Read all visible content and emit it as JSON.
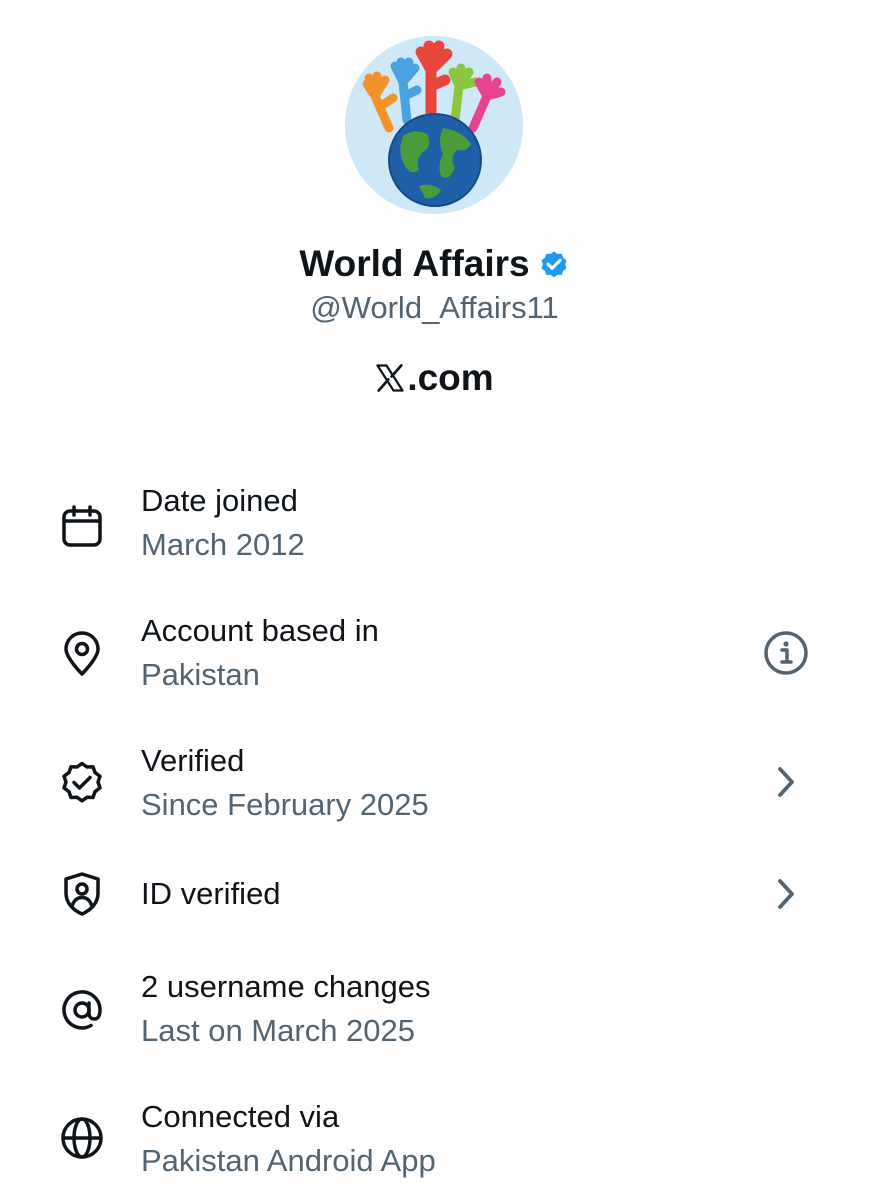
{
  "profile": {
    "display_name": "World Affairs",
    "handle": "@World_Affairs11",
    "verified_icon": "verified-badge-icon",
    "avatar_icon": "globe-with-raised-hands-avatar"
  },
  "brand": {
    "logo_icon": "x-logo-icon",
    "domain_text": ".com"
  },
  "colors": {
    "verified_blue": "#1d9bf0",
    "primary_text": "#0f1419",
    "secondary_text": "#536471"
  },
  "rows": [
    {
      "icon": "calendar-icon",
      "title": "Date joined",
      "subtitle": "March 2012"
    },
    {
      "icon": "location-pin-icon",
      "title": "Account based in",
      "subtitle": "Pakistan",
      "action_icon": "info-icon"
    },
    {
      "icon": "verified-badge-outline-icon",
      "title": "Verified",
      "subtitle": "Since February 2025",
      "action_icon": "chevron-right-icon"
    },
    {
      "icon": "shield-person-icon",
      "title": "ID verified",
      "action_icon": "chevron-right-icon"
    },
    {
      "icon": "at-sign-icon",
      "title": "2 username changes",
      "subtitle": "Last on March 2025"
    },
    {
      "icon": "globe-icon",
      "title": "Connected via",
      "subtitle": "Pakistan Android App"
    }
  ]
}
